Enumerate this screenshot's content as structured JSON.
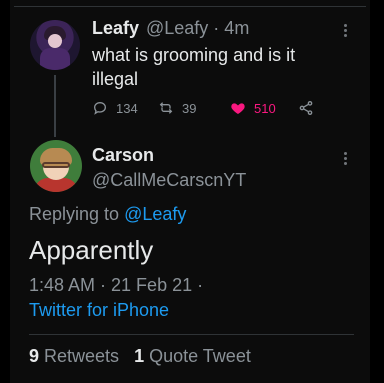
{
  "parent_tweet": {
    "display_name": "Leafy",
    "handle_time": "@Leafy · 4m",
    "text": "what is grooming and is it illegal",
    "replies": "134",
    "retweets": "39",
    "likes": "510",
    "liked": true
  },
  "main_tweet": {
    "display_name": "Carson",
    "handle": "@CallMeCarscnYT",
    "replying_label": "Replying to ",
    "replying_handle": "@Leafy",
    "text": "Apparently",
    "timestamp": "1:48 AM · 21 Feb 21 ·",
    "source": "Twitter for iPhone",
    "retweet_count": "9",
    "retweet_label": " Retweets",
    "quote_count": "1",
    "quote_label": " Quote Tweet"
  },
  "icons": {
    "reply": "reply-icon",
    "retweet": "retweet-icon",
    "like": "heart-icon",
    "share": "share-icon",
    "more": "more-icon"
  },
  "colors": {
    "background": "#000000",
    "text_primary": "#e7e9ea",
    "text_secondary": "#8b9298",
    "link": "#1d9bf0",
    "like": "#f91880"
  }
}
